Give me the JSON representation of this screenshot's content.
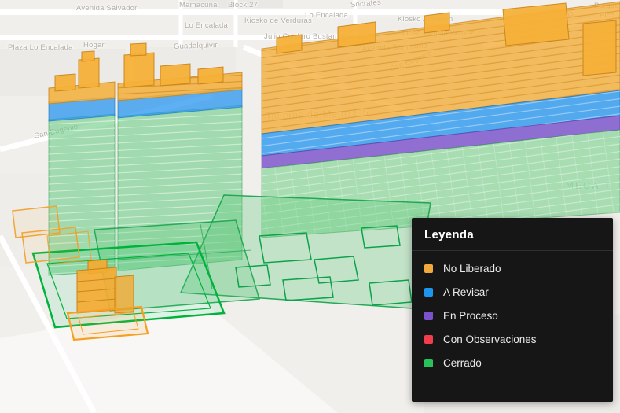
{
  "legend": {
    "title": "Leyenda",
    "items": [
      {
        "label": "No Liberado",
        "color": "#f2a93b"
      },
      {
        "label": "A Revisar",
        "color": "#1e96f0"
      },
      {
        "label": "En Proceso",
        "color": "#7a52cc"
      },
      {
        "label": "Con Observaciones",
        "color": "#f23d4c"
      },
      {
        "label": "Cerrado",
        "color": "#27c25a"
      }
    ]
  },
  "map": {
    "labels": [
      {
        "text": "Avenida Salvador"
      },
      {
        "text": "Mamacuna"
      },
      {
        "text": "Block 27"
      },
      {
        "text": "Socrates"
      },
      {
        "text": "Lo Encalada"
      },
      {
        "text": "Kiosko de Verduras"
      },
      {
        "text": "Lo Encalada"
      },
      {
        "text": "Julio Cordero Bustamante"
      },
      {
        "text": "Kiosko Almacen"
      },
      {
        "text": "Liceo Brígida Walker"
      },
      {
        "text": "Avenida Seminario"
      },
      {
        "text": "San Eugenio"
      },
      {
        "text": "Guadalquivir"
      },
      {
        "text": "Plaza Lo Encalada"
      },
      {
        "text": "Hogar"
      },
      {
        "text": "San Eugenio"
      },
      {
        "text": "Talleres de Metro L 5"
      },
      {
        "text": "San Eugenio"
      },
      {
        "text": "Parque"
      },
      {
        "text": "Picó"
      },
      {
        "text": "MEGA T"
      }
    ],
    "status_colors": {
      "no_liberado": "#f2a93b",
      "a_revisar": "#1e96f0",
      "en_proceso": "#7a52cc",
      "con_observaciones": "#f23d4c",
      "cerrado": "#27c25a"
    }
  }
}
